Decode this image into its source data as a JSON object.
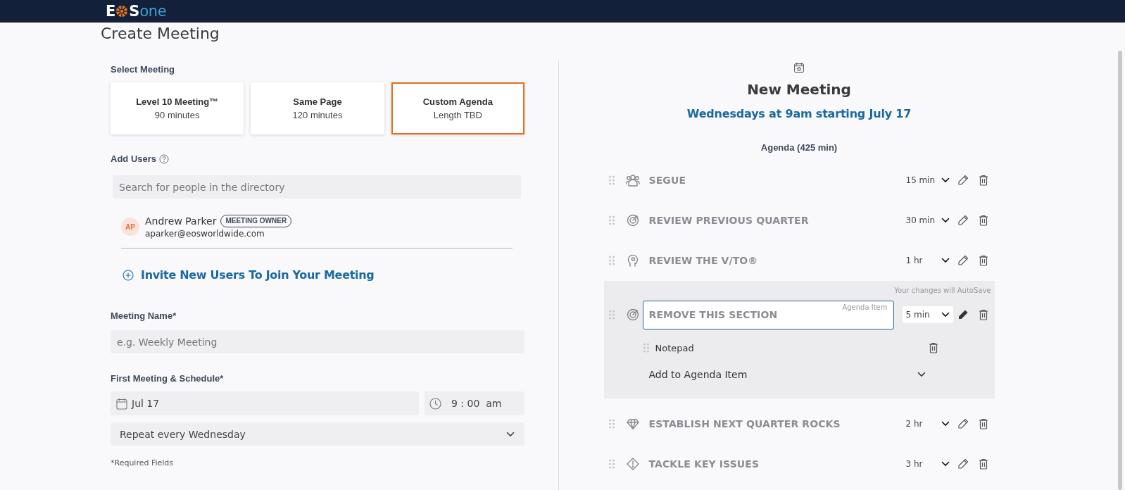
{
  "top_bar": {
    "logo": {
      "letter_1": "E",
      "letter_2": "S",
      "suffix": "one"
    }
  },
  "page_title": "Create Meeting",
  "form": {
    "select_label": "Select Meeting",
    "meeting_types": [
      {
        "title": "Level 10 Meeting™",
        "subtitle": "90 minutes",
        "selected": false
      },
      {
        "title": "Same Page",
        "subtitle": "120 minutes",
        "selected": false
      },
      {
        "title": "Custom Agenda",
        "subtitle": "Length TBD",
        "selected": true
      }
    ],
    "users_label": "Add Users",
    "user_search": {
      "placeholder": "Search for people in the directory"
    },
    "users": [
      {
        "initials": "AP",
        "name": "Andrew Parker",
        "badge": "MEETING OWNER",
        "email": "aparker@eosworldwide.com"
      }
    ],
    "invite_link": "Invite New Users To Join Your Meeting",
    "name_label": "Meeting Name*",
    "name_field": {
      "placeholder": "e.g. Weekly Meeting"
    },
    "schedule_label": "First Meeting & Schedule*",
    "date_field": {
      "value": "Jul 17"
    },
    "time_field": {
      "hour": "9",
      "separator": ":",
      "minute": "00",
      "period": "am"
    },
    "repeat_dropdown": {
      "value": "Repeat every Wednesday"
    },
    "required_note": "*Required Fields"
  },
  "preview": {
    "title": "New Meeting",
    "schedule": "Wednesdays at 9am starting July 17",
    "agenda_heading": "Agenda (425 min)",
    "autosave_note": "Your changes will AutoSave",
    "agenda_items": [
      {
        "title": "SEGUE",
        "duration": "15 min",
        "expanded": false
      },
      {
        "title": "REVIEW PREVIOUS QUARTER",
        "duration": "30 min",
        "expanded": false
      },
      {
        "title": "REVIEW THE V/TO®",
        "duration": "1 hr",
        "expanded": false
      },
      {
        "title": "REMOVE THIS SECTION",
        "duration": "5 min",
        "expanded": true,
        "field_label": "Agenda Item",
        "sub_items": [
          {
            "label": "Notepad"
          }
        ],
        "add_dropdown": "Add to Agenda Item"
      },
      {
        "title": "ESTABLISH NEXT QUARTER ROCKS",
        "duration": "2 hr",
        "expanded": false
      },
      {
        "title": "TACKLE KEY ISSUES",
        "duration": "3 hr",
        "expanded": false
      }
    ]
  }
}
